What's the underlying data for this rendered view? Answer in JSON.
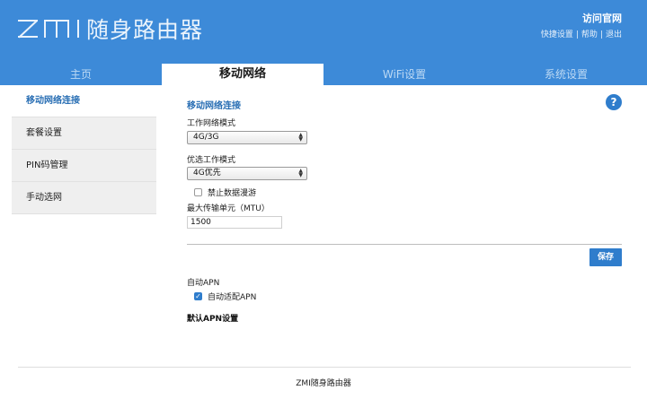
{
  "header": {
    "brand_logo": "ZMI",
    "brand_title": "随身路由器",
    "official_link": "访问官网",
    "quick_links": [
      "快捷设置",
      "帮助",
      "退出"
    ],
    "background_color": "#3d8ad8"
  },
  "nav": {
    "tabs": [
      {
        "label": "主页",
        "active": false
      },
      {
        "label": "移动网络",
        "active": true
      },
      {
        "label": "WiFi设置",
        "active": false
      },
      {
        "label": "系统设置",
        "active": false
      }
    ]
  },
  "sidebar": {
    "items": [
      {
        "label": "移动网络连接",
        "active": true
      },
      {
        "label": "套餐设置",
        "active": false
      },
      {
        "label": "PIN码管理",
        "active": false
      },
      {
        "label": "手动选网",
        "active": false
      }
    ]
  },
  "main": {
    "section_title": "移动网络连接",
    "help_icon": "question-circle-icon",
    "work_mode": {
      "label": "工作网络模式",
      "value": "4G/3G"
    },
    "preferred_mode": {
      "label": "优选工作模式",
      "value": "4G优先"
    },
    "disable_roaming": {
      "label": "禁止数据漫游",
      "checked": false
    },
    "mtu": {
      "label": "最大传输单元（MTU）",
      "value": "1500"
    },
    "save_label": "保存",
    "auto_apn": {
      "section_label": "自动APN",
      "checkbox_label": "自动适配APN",
      "checked": true
    },
    "default_apn_label": "默认APN设置"
  },
  "footer": {
    "text": "ZMI随身路由器"
  },
  "colors": {
    "accent": "#2f7dcc",
    "active_sidebar_text": "#2a6fb4"
  }
}
